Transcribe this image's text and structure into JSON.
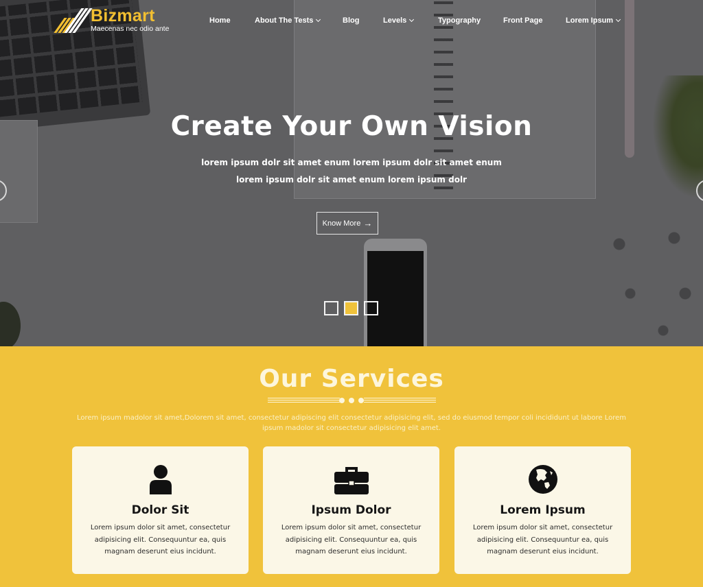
{
  "brand": {
    "name": "Bizmart",
    "tagline": "Maecenas nec odio ante",
    "accent_color": "#f0c23b"
  },
  "nav": {
    "items": [
      {
        "label": "Home",
        "has_dropdown": false
      },
      {
        "label": "About The Tests",
        "has_dropdown": true
      },
      {
        "label": "Blog",
        "has_dropdown": false
      },
      {
        "label": "Levels",
        "has_dropdown": true
      },
      {
        "label": "Typography",
        "has_dropdown": false
      },
      {
        "label": "Front Page",
        "has_dropdown": false
      },
      {
        "label": "Lorem Ipsum",
        "has_dropdown": true
      }
    ]
  },
  "hero": {
    "title": "Create Your Own Vision",
    "subtitle_line1": "lorem ipsum dolr sit amet enum lorem ipsum dolr sit amet enum",
    "subtitle_line2": "lorem ipsum dolr sit amet enum lorem ipsum dolr",
    "cta_label": "Know More",
    "cta_icon": "arrow-right-icon",
    "slides_total": 3,
    "active_slide": 2,
    "prev_icon": "chevron-left-icon",
    "next_icon": "chevron-right-icon"
  },
  "services": {
    "title": "Our Services",
    "description": "Lorem ipsum madolor sit amet,Dolorem sit amet, consectetur adipiscing elit consectetur adipisicing elit, sed do eiusmod tempor coli incididunt ut labore Lorem ipsum madolor sit consectetur adipisicing elit amet.",
    "cards": [
      {
        "icon": "user-icon",
        "title": "Dolor Sit",
        "text": "Lorem ipsum dolor sit amet, consectetur adipisicing elit. Consequuntur ea, quis magnam deserunt eius incidunt."
      },
      {
        "icon": "briefcase-icon",
        "title": "Ipsum Dolor",
        "text": "Lorem ipsum dolor sit amet, consectetur adipisicing elit. Consequuntur ea, quis magnam deserunt eius incidunt."
      },
      {
        "icon": "globe-icon",
        "title": "Lorem Ipsum",
        "text": "Lorem ipsum dolor sit amet, consectetur adipisicing elit. Consequuntur ea, quis magnam deserunt eius incidunt."
      }
    ]
  }
}
